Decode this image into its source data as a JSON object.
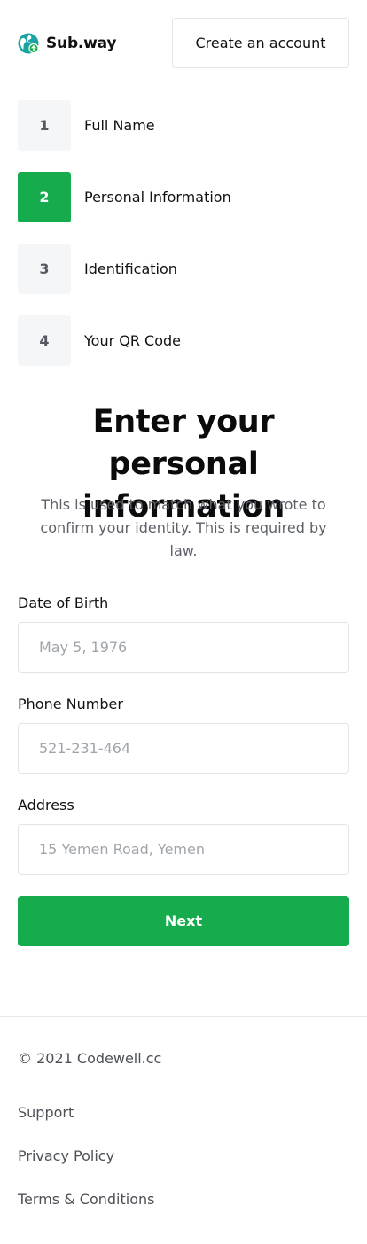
{
  "header": {
    "brand": "Sub.way",
    "logo_icon": "globe-icon",
    "brand_color": "#16ac4d",
    "create_account_label": "Create an account"
  },
  "steps": [
    {
      "number": "1",
      "label": "Full Name",
      "active": false
    },
    {
      "number": "2",
      "label": "Personal Information",
      "active": true
    },
    {
      "number": "3",
      "label": "Identification",
      "active": false
    },
    {
      "number": "4",
      "label": "Your QR Code",
      "active": false
    }
  ],
  "main": {
    "title": "Enter your personal information",
    "subtitle": "This is used to match what you wrote to confirm your identity. This is required by law."
  },
  "form": {
    "dob_label": "Date of Birth",
    "dob_placeholder": "May 5, 1976",
    "dob_value": "",
    "phone_label": "Phone Number",
    "phone_placeholder": "521-231-464",
    "phone_value": "",
    "address_label": "Address",
    "address_placeholder": "15 Yemen Road, Yemen",
    "address_value": "",
    "next_label": "Next"
  },
  "footer": {
    "copyright": "© 2021 Codewell.cc",
    "links": [
      "Support",
      "Privacy Policy",
      "Terms & Conditions"
    ]
  },
  "colors": {
    "accent": "#16ac4d",
    "step_inactive_bg": "#f5f6f8",
    "border": "#e2e4e8"
  }
}
